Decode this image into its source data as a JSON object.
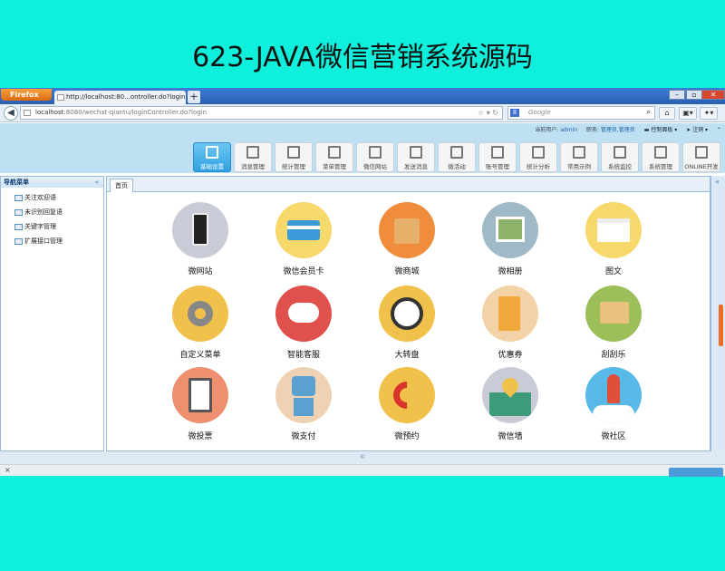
{
  "headline": "623-JAVA微信营销系统源码",
  "browser": {
    "firefox_label": "Firefox",
    "tab_title": "http://localhost:80...ontroller.do?login",
    "new_tab": "+",
    "url_host": "localhost",
    "url_path": ":8080/wechat-qiantu/loginController.do?login",
    "search_placeholder": "Google",
    "search_engine": "8",
    "status_close": "×"
  },
  "app": {
    "user_label": "当前用户:",
    "user_name": "admin",
    "role_label": "职务:",
    "role_value": "管理员,管理员",
    "control_panel": "控制面板",
    "logout": "注销",
    "toolbar": [
      {
        "label": "基础设置",
        "active": true,
        "icon": "edit-icon"
      },
      {
        "label": "消息管理",
        "active": false,
        "icon": "edit-icon"
      },
      {
        "label": "统计管理",
        "active": false,
        "icon": "bar-chart-icon"
      },
      {
        "label": "菜单管理",
        "active": false,
        "icon": "edit-icon"
      },
      {
        "label": "微信网站",
        "active": false,
        "icon": "edit-icon"
      },
      {
        "label": "发送消息",
        "active": false,
        "icon": "edit-icon"
      },
      {
        "label": "微活动",
        "active": false,
        "icon": "edit-icon"
      },
      {
        "label": "账号管理",
        "active": false,
        "icon": "edit-icon"
      },
      {
        "label": "统计分析",
        "active": false,
        "icon": "edit-icon"
      },
      {
        "label": "常用示例",
        "active": false,
        "icon": "grid-icon"
      },
      {
        "label": "系统监控",
        "active": false,
        "icon": "monitor-icon"
      },
      {
        "label": "系统管理",
        "active": false,
        "icon": "settings-icon"
      },
      {
        "label": "ONLINE开发",
        "active": false,
        "icon": "edit-icon"
      }
    ],
    "sidebar": {
      "title": "导航菜单",
      "items": [
        "关注欢迎语",
        "未识别回复语",
        "关键字管理",
        "扩展接口管理"
      ]
    },
    "main_tab": "首页",
    "tiles": [
      {
        "label": "微网站",
        "icon": "phone-icon",
        "color": "#c9cbd6"
      },
      {
        "label": "微信会员卡",
        "icon": "member-card-icon",
        "color": "#f6d86b"
      },
      {
        "label": "微商城",
        "icon": "shopping-bag-icon",
        "color": "#f08d3c"
      },
      {
        "label": "微相册",
        "icon": "photo-icon",
        "color": "#9fb9c6"
      },
      {
        "label": "图文",
        "icon": "web-page-icon",
        "color": "#f6d86b"
      },
      {
        "label": "自定义菜单",
        "icon": "gear-icon",
        "color": "#f0c14b"
      },
      {
        "label": "智能客服",
        "icon": "chat-bubble-icon",
        "color": "#e0504c"
      },
      {
        "label": "大转盘",
        "icon": "clock-icon",
        "color": "#f0c14b"
      },
      {
        "label": "优惠券",
        "icon": "coupon-icon",
        "color": "#f2d2a6"
      },
      {
        "label": "刮刮乐",
        "icon": "scratch-card-icon",
        "color": "#9cbf5a"
      },
      {
        "label": "微投票",
        "icon": "clipboard-icon",
        "color": "#ee8f70"
      },
      {
        "label": "微支付",
        "icon": "robot-icon",
        "color": "#efd2b3"
      },
      {
        "label": "微预约",
        "icon": "telephone-icon",
        "color": "#f0c14b"
      },
      {
        "label": "微信墙",
        "icon": "map-pin-icon",
        "color": "#c9cbd6"
      },
      {
        "label": "微社区",
        "icon": "rocket-icon",
        "color": "#58b8e8"
      }
    ],
    "footer": "©"
  }
}
